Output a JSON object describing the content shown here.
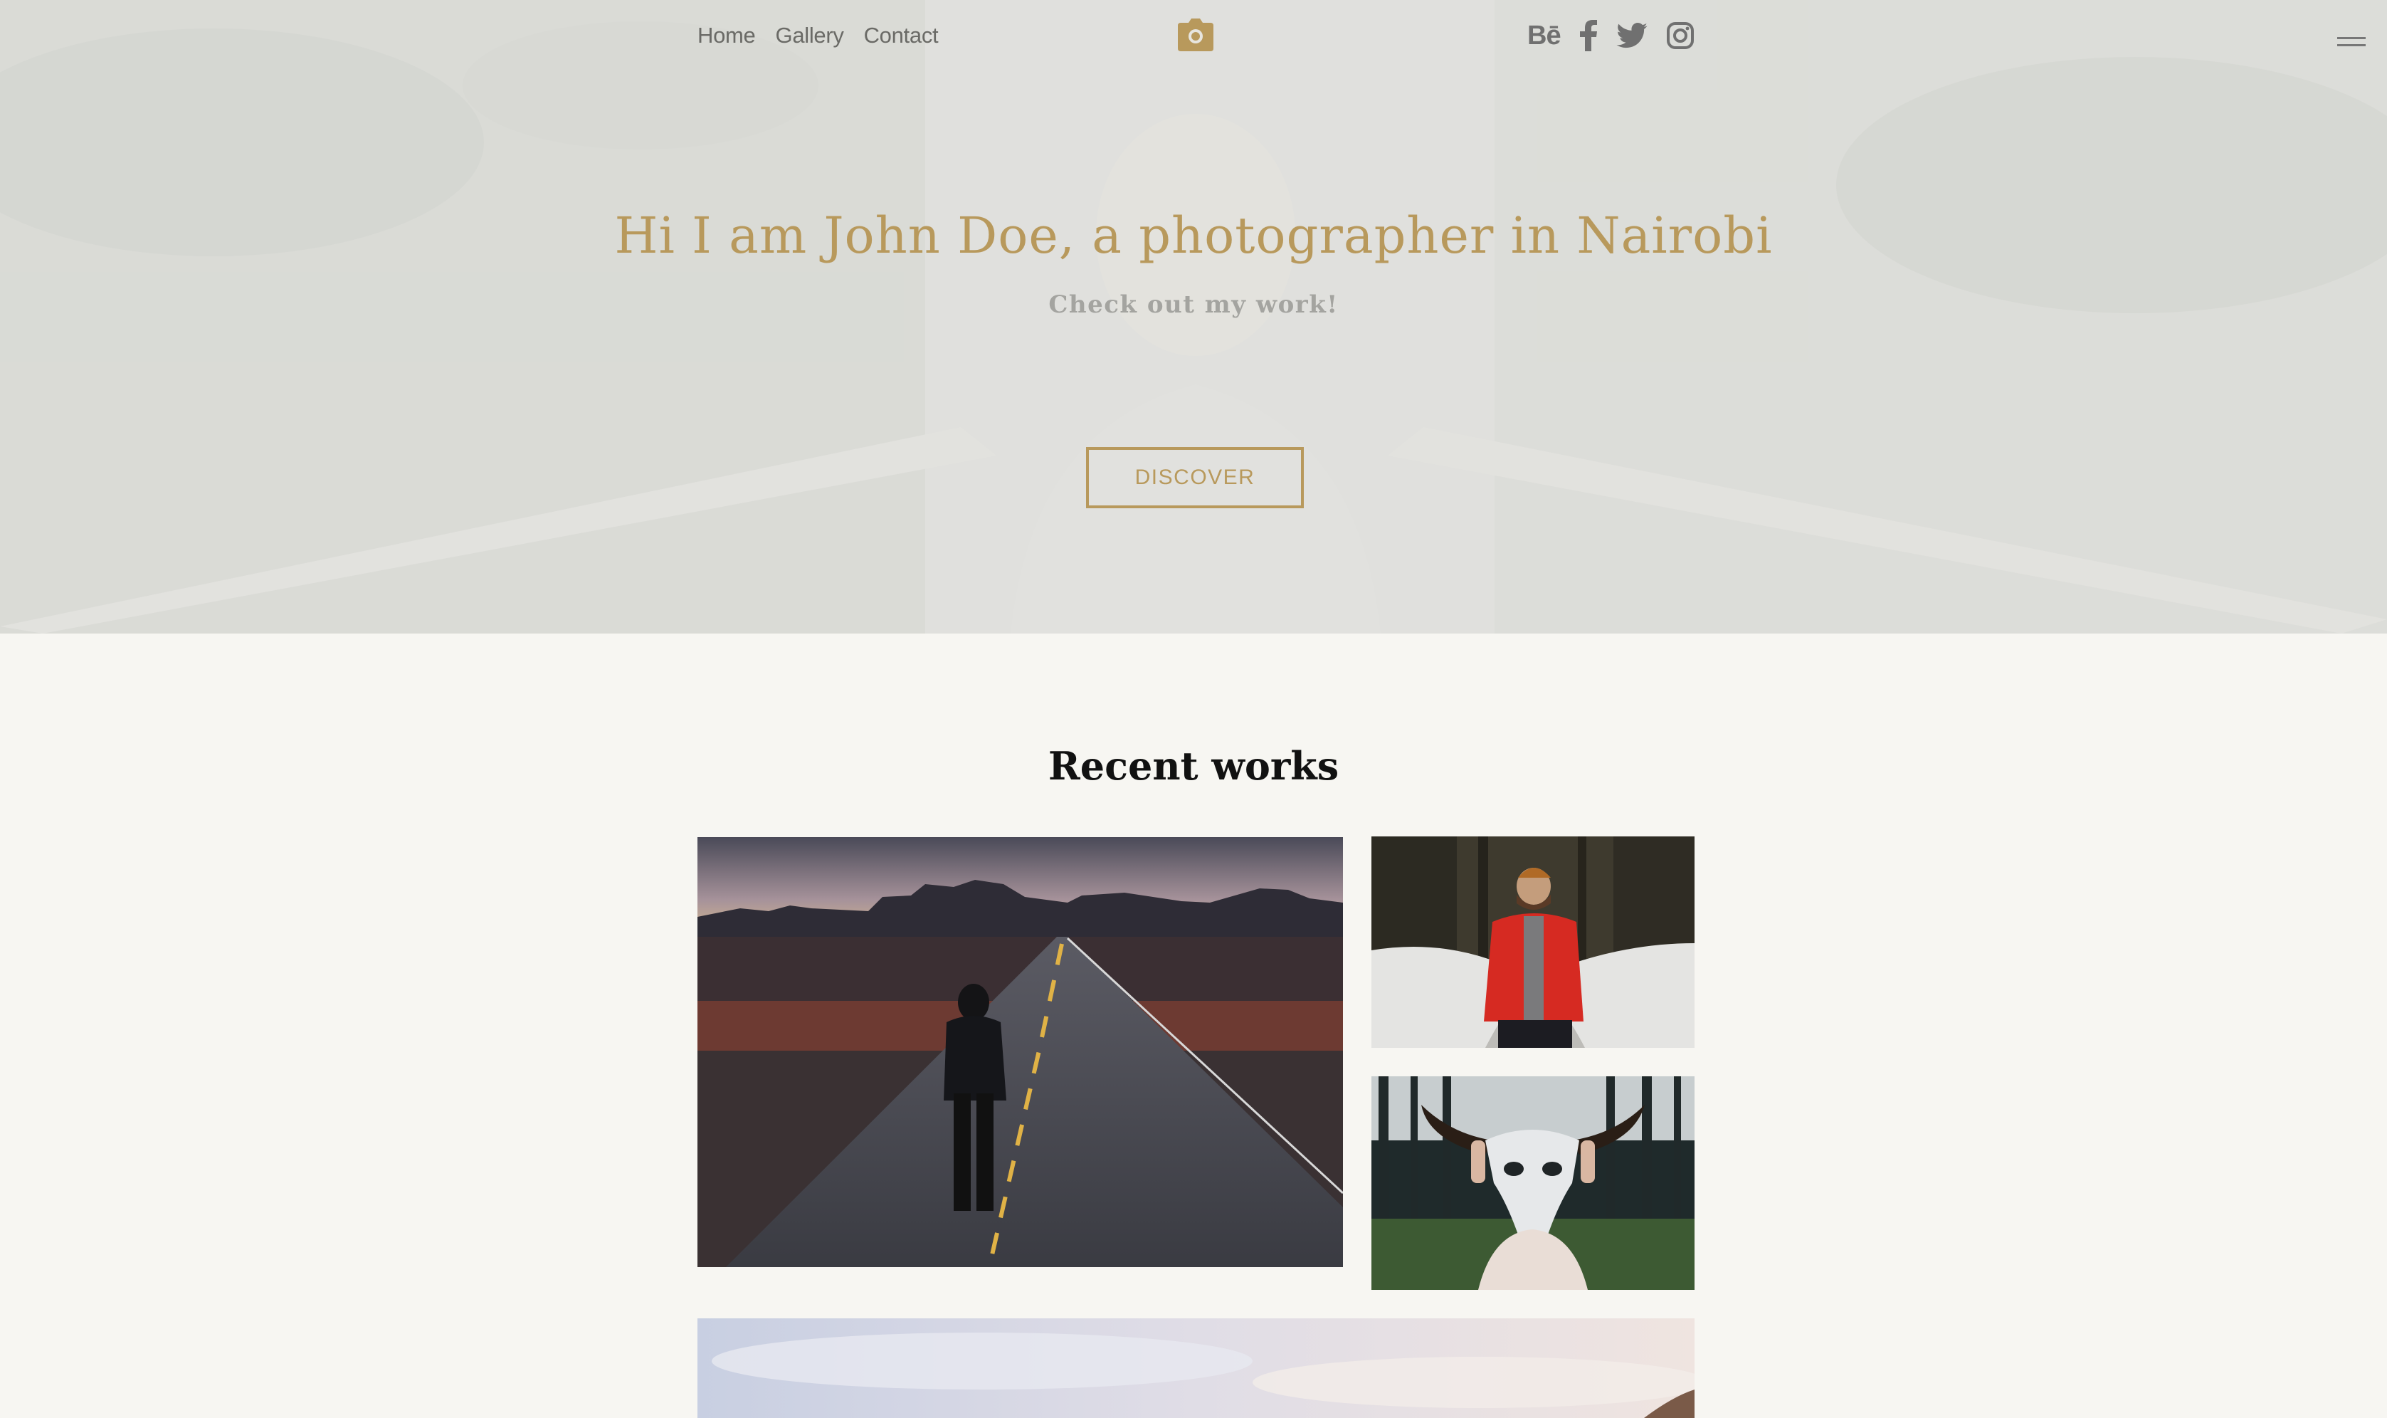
{
  "nav": {
    "items": [
      "Home",
      "Gallery",
      "Contact"
    ]
  },
  "logo": {
    "icon": "camera-icon"
  },
  "social": {
    "behance_label": "Bē",
    "icons": [
      "behance-icon",
      "facebook-icon",
      "twitter-icon",
      "instagram-icon"
    ]
  },
  "menu": {
    "icon": "menu-icon"
  },
  "hero": {
    "title": "Hi I am John Doe, a photographer in Nairobi",
    "subtitle": "Check out my work!",
    "cta_label": "DISCOVER"
  },
  "works": {
    "title": "Recent works"
  },
  "colors": {
    "accent": "#b8995c",
    "background": "#f7f6f2",
    "nav_text": "#6a6a66"
  }
}
